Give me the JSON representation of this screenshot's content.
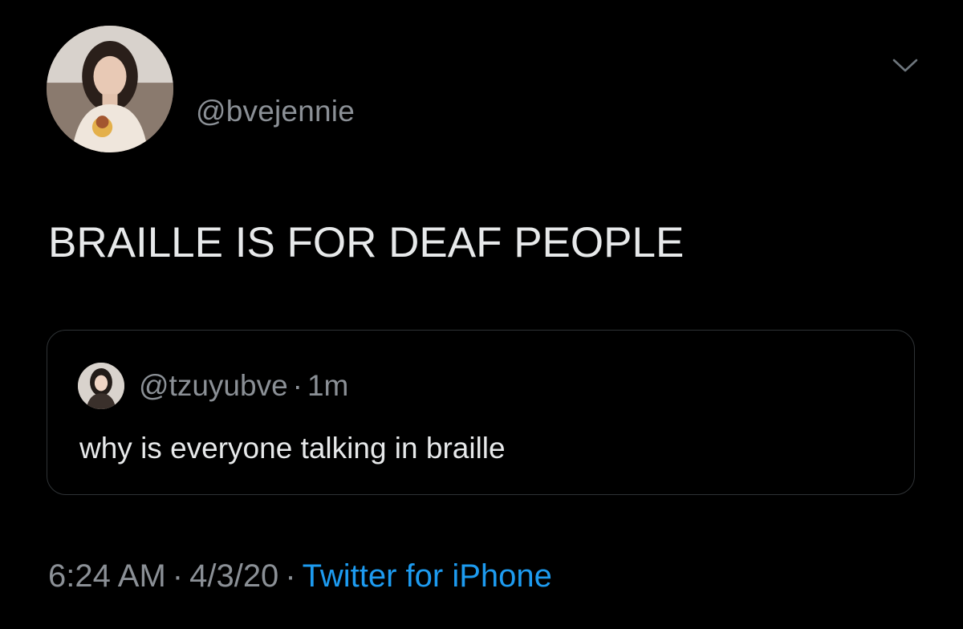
{
  "tweet": {
    "author_handle": "@bvejennie",
    "text": "BRAILLE IS FOR DEAF PEOPLE",
    "menu_icon": "chevron-down-icon"
  },
  "quoted_tweet": {
    "author_handle": "@tzuyubve",
    "separator": "·",
    "age": "1m",
    "text": "why is everyone talking in braille"
  },
  "meta": {
    "time": "6:24 AM",
    "separator": "·",
    "date": "4/3/20",
    "source": "Twitter for iPhone"
  },
  "colors": {
    "background": "#000000",
    "primary_text": "#e7e9ea",
    "secondary_text": "#8b9096",
    "link": "#1d9bf0",
    "border": "#2f3336"
  }
}
